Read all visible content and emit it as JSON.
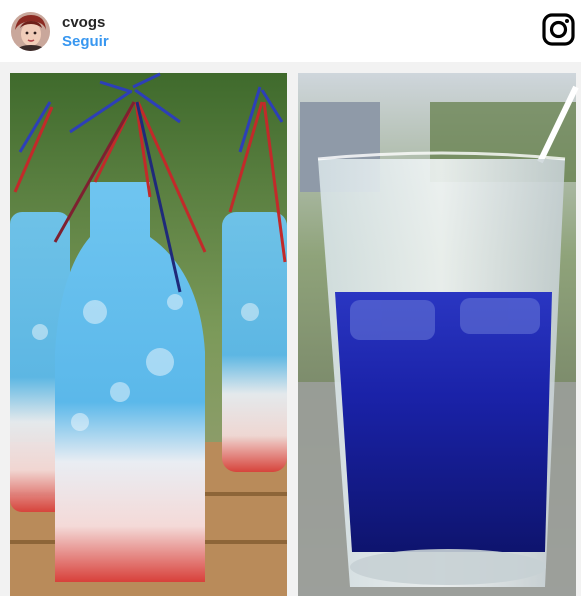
{
  "post": {
    "username": "cvogs",
    "follow_label": "Seguir",
    "logo_icon": "instagram-icon"
  },
  "colors": {
    "username": "#262626",
    "follow": "#3897f0",
    "drink_blue": "#1a22a8",
    "drink_red": "#d8403a",
    "drink_light_blue": "#5bb8ea"
  }
}
